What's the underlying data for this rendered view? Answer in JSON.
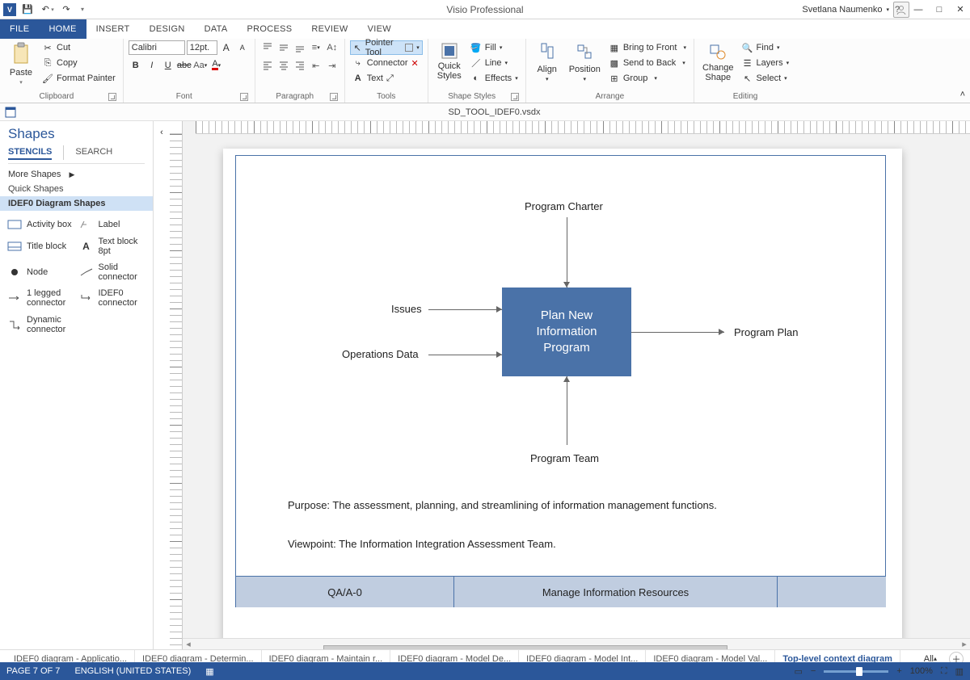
{
  "app": {
    "name": "V",
    "title": "Visio Professional",
    "documentName": "SD_TOOL_IDEF0.vsdx"
  },
  "user": {
    "name": "Svetlana Naumenko"
  },
  "windowControls": {
    "help": "?",
    "minimize": "—",
    "restore": "□",
    "close": "✕"
  },
  "qat": {
    "save": "💾",
    "undo": "↶",
    "redo": "↷",
    "customize": "▾"
  },
  "tabs": {
    "file": "FILE",
    "home": "HOME",
    "insert": "INSERT",
    "design": "DESIGN",
    "data": "DATA",
    "process": "PROCESS",
    "review": "REVIEW",
    "view": "VIEW"
  },
  "ribbon": {
    "clipboard": {
      "label": "Clipboard",
      "paste": "Paste",
      "cut": "Cut",
      "copy": "Copy",
      "formatPainter": "Format Painter"
    },
    "font": {
      "label": "Font",
      "name": "Calibri",
      "size": "12pt."
    },
    "paragraph": {
      "label": "Paragraph"
    },
    "tools": {
      "label": "Tools",
      "pointer": "Pointer Tool",
      "connector": "Connector",
      "text": "Text"
    },
    "shapeStyles": {
      "label": "Shape Styles",
      "quick": "Quick\nStyles",
      "fill": "Fill",
      "line": "Line",
      "effects": "Effects"
    },
    "arrange": {
      "label": "Arrange",
      "align": "Align",
      "position": "Position",
      "bringFront": "Bring to Front",
      "sendBack": "Send to Back",
      "group": "Group"
    },
    "editing": {
      "label": "Editing",
      "changeShape": "Change\nShape",
      "find": "Find",
      "layers": "Layers",
      "select": "Select"
    }
  },
  "shapes": {
    "title": "Shapes",
    "tabs": {
      "stencils": "STENCILS",
      "search": "SEARCH"
    },
    "more": "More Shapes",
    "quick": "Quick Shapes",
    "current": "IDEF0 Diagram Shapes",
    "items": {
      "activity": "Activity box",
      "label": "Label",
      "titleBlock": "Title block",
      "textBlock": "Text block 8pt",
      "node": "Node",
      "solidConn": "Solid connector",
      "oneLeg": "1 legged connector",
      "idef0Conn": "IDEF0 connector",
      "dynamic": "Dynamic connector"
    }
  },
  "diagram": {
    "top": "Program Charter",
    "left1": "Issues",
    "left2": "Operations Data",
    "box": "Plan New Information Program",
    "right": "Program Plan",
    "bottom": "Program Team",
    "purpose": "Purpose:  The assessment, planning, and streamlining of information management functions.",
    "viewpoint": "Viewpoint:  The Information Integration Assessment Team.",
    "footerLeft": "QA/A-0",
    "footerCenter": "Manage Information Resources",
    "footerRight": ""
  },
  "sheets": {
    "s1": "IDEF0 diagram - Applicatio...",
    "s2": "IDEF0 diagram - Determin...",
    "s3": "IDEF0 diagram - Maintain r...",
    "s4": "IDEF0 diagram - Model De...",
    "s5": "IDEF0 diagram - Model Int...",
    "s6": "IDEF0 diagram - Model Val...",
    "s7": "Top-level context diagram",
    "all": "All"
  },
  "status": {
    "page": "PAGE 7 OF 7",
    "lang": "ENGLISH (UNITED STATES)",
    "zoom": "100%"
  }
}
